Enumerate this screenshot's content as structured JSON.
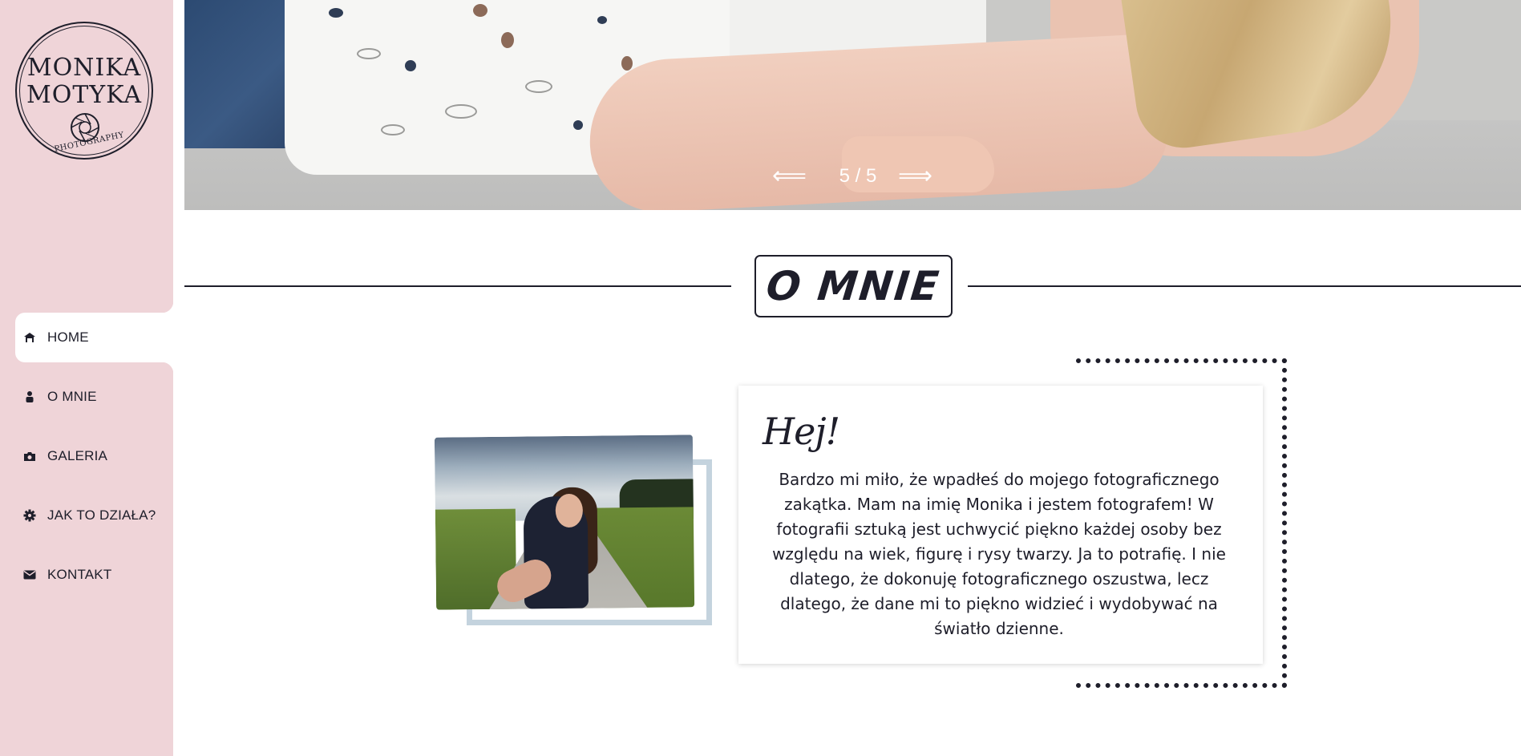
{
  "sidebar": {
    "logo": {
      "line1": "MONIKA",
      "line2": "MOTYKA",
      "subtitle": "PHOTOGRAPHY",
      "icon": "aperture-icon"
    },
    "nav": [
      {
        "label": "HOME",
        "icon": "home-icon",
        "active": true
      },
      {
        "label": "O MNIE",
        "icon": "person-icon",
        "active": false
      },
      {
        "label": "GALERIA",
        "icon": "camera-icon",
        "active": false
      },
      {
        "label": "JAK TO DZIAŁA?",
        "icon": "gear-icon",
        "active": false
      },
      {
        "label": "KONTAKT",
        "icon": "envelope-icon",
        "active": false
      }
    ]
  },
  "slider": {
    "prev_arrow": "⟸",
    "next_arrow": "⟹",
    "counter": "5 / 5"
  },
  "about": {
    "heading": "O MNIE",
    "card_title": "Hej!",
    "card_text": "Bardzo mi miło, że wpadłeś do mojego fotograficznego zakątka. Mam na imię Monika i jestem fotografem! W fotografii sztuką jest uchwycić piękno każdej osoby bez względu na wiek, figurę i rysy twarzy. Ja to potrafię. I nie dlatego, że dokonuję fotograficznego oszustwa, lecz dlatego, że dane mi to piękno widzieć i wydobywać na światło dzienne."
  },
  "colors": {
    "sidebar_bg": "#efd4d8",
    "text_dark": "#1e1e2a",
    "photo_frame": "#c4d3de"
  }
}
